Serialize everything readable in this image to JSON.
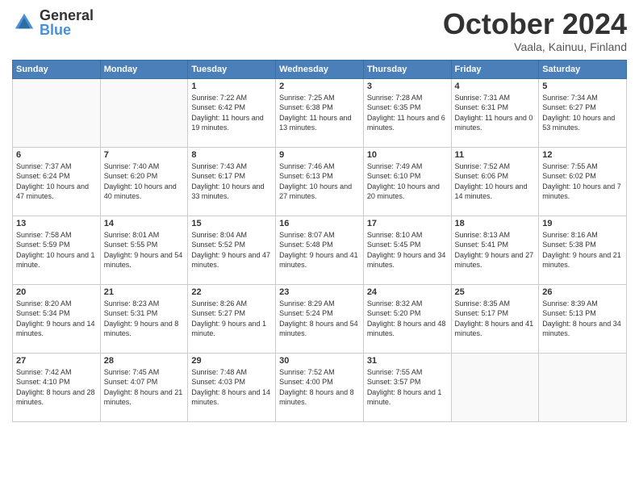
{
  "logo": {
    "general": "General",
    "blue": "Blue"
  },
  "title": "October 2024",
  "location": "Vaala, Kainuu, Finland",
  "days_of_week": [
    "Sunday",
    "Monday",
    "Tuesday",
    "Wednesday",
    "Thursday",
    "Friday",
    "Saturday"
  ],
  "weeks": [
    [
      {
        "day": "",
        "info": ""
      },
      {
        "day": "",
        "info": ""
      },
      {
        "day": "1",
        "info": "Sunrise: 7:22 AM\nSunset: 6:42 PM\nDaylight: 11 hours and 19 minutes."
      },
      {
        "day": "2",
        "info": "Sunrise: 7:25 AM\nSunset: 6:38 PM\nDaylight: 11 hours and 13 minutes."
      },
      {
        "day": "3",
        "info": "Sunrise: 7:28 AM\nSunset: 6:35 PM\nDaylight: 11 hours and 6 minutes."
      },
      {
        "day": "4",
        "info": "Sunrise: 7:31 AM\nSunset: 6:31 PM\nDaylight: 11 hours and 0 minutes."
      },
      {
        "day": "5",
        "info": "Sunrise: 7:34 AM\nSunset: 6:27 PM\nDaylight: 10 hours and 53 minutes."
      }
    ],
    [
      {
        "day": "6",
        "info": "Sunrise: 7:37 AM\nSunset: 6:24 PM\nDaylight: 10 hours and 47 minutes."
      },
      {
        "day": "7",
        "info": "Sunrise: 7:40 AM\nSunset: 6:20 PM\nDaylight: 10 hours and 40 minutes."
      },
      {
        "day": "8",
        "info": "Sunrise: 7:43 AM\nSunset: 6:17 PM\nDaylight: 10 hours and 33 minutes."
      },
      {
        "day": "9",
        "info": "Sunrise: 7:46 AM\nSunset: 6:13 PM\nDaylight: 10 hours and 27 minutes."
      },
      {
        "day": "10",
        "info": "Sunrise: 7:49 AM\nSunset: 6:10 PM\nDaylight: 10 hours and 20 minutes."
      },
      {
        "day": "11",
        "info": "Sunrise: 7:52 AM\nSunset: 6:06 PM\nDaylight: 10 hours and 14 minutes."
      },
      {
        "day": "12",
        "info": "Sunrise: 7:55 AM\nSunset: 6:02 PM\nDaylight: 10 hours and 7 minutes."
      }
    ],
    [
      {
        "day": "13",
        "info": "Sunrise: 7:58 AM\nSunset: 5:59 PM\nDaylight: 10 hours and 1 minute."
      },
      {
        "day": "14",
        "info": "Sunrise: 8:01 AM\nSunset: 5:55 PM\nDaylight: 9 hours and 54 minutes."
      },
      {
        "day": "15",
        "info": "Sunrise: 8:04 AM\nSunset: 5:52 PM\nDaylight: 9 hours and 47 minutes."
      },
      {
        "day": "16",
        "info": "Sunrise: 8:07 AM\nSunset: 5:48 PM\nDaylight: 9 hours and 41 minutes."
      },
      {
        "day": "17",
        "info": "Sunrise: 8:10 AM\nSunset: 5:45 PM\nDaylight: 9 hours and 34 minutes."
      },
      {
        "day": "18",
        "info": "Sunrise: 8:13 AM\nSunset: 5:41 PM\nDaylight: 9 hours and 27 minutes."
      },
      {
        "day": "19",
        "info": "Sunrise: 8:16 AM\nSunset: 5:38 PM\nDaylight: 9 hours and 21 minutes."
      }
    ],
    [
      {
        "day": "20",
        "info": "Sunrise: 8:20 AM\nSunset: 5:34 PM\nDaylight: 9 hours and 14 minutes."
      },
      {
        "day": "21",
        "info": "Sunrise: 8:23 AM\nSunset: 5:31 PM\nDaylight: 9 hours and 8 minutes."
      },
      {
        "day": "22",
        "info": "Sunrise: 8:26 AM\nSunset: 5:27 PM\nDaylight: 9 hours and 1 minute."
      },
      {
        "day": "23",
        "info": "Sunrise: 8:29 AM\nSunset: 5:24 PM\nDaylight: 8 hours and 54 minutes."
      },
      {
        "day": "24",
        "info": "Sunrise: 8:32 AM\nSunset: 5:20 PM\nDaylight: 8 hours and 48 minutes."
      },
      {
        "day": "25",
        "info": "Sunrise: 8:35 AM\nSunset: 5:17 PM\nDaylight: 8 hours and 41 minutes."
      },
      {
        "day": "26",
        "info": "Sunrise: 8:39 AM\nSunset: 5:13 PM\nDaylight: 8 hours and 34 minutes."
      }
    ],
    [
      {
        "day": "27",
        "info": "Sunrise: 7:42 AM\nSunset: 4:10 PM\nDaylight: 8 hours and 28 minutes."
      },
      {
        "day": "28",
        "info": "Sunrise: 7:45 AM\nSunset: 4:07 PM\nDaylight: 8 hours and 21 minutes."
      },
      {
        "day": "29",
        "info": "Sunrise: 7:48 AM\nSunset: 4:03 PM\nDaylight: 8 hours and 14 minutes."
      },
      {
        "day": "30",
        "info": "Sunrise: 7:52 AM\nSunset: 4:00 PM\nDaylight: 8 hours and 8 minutes."
      },
      {
        "day": "31",
        "info": "Sunrise: 7:55 AM\nSunset: 3:57 PM\nDaylight: 8 hours and 1 minute."
      },
      {
        "day": "",
        "info": ""
      },
      {
        "day": "",
        "info": ""
      }
    ]
  ]
}
